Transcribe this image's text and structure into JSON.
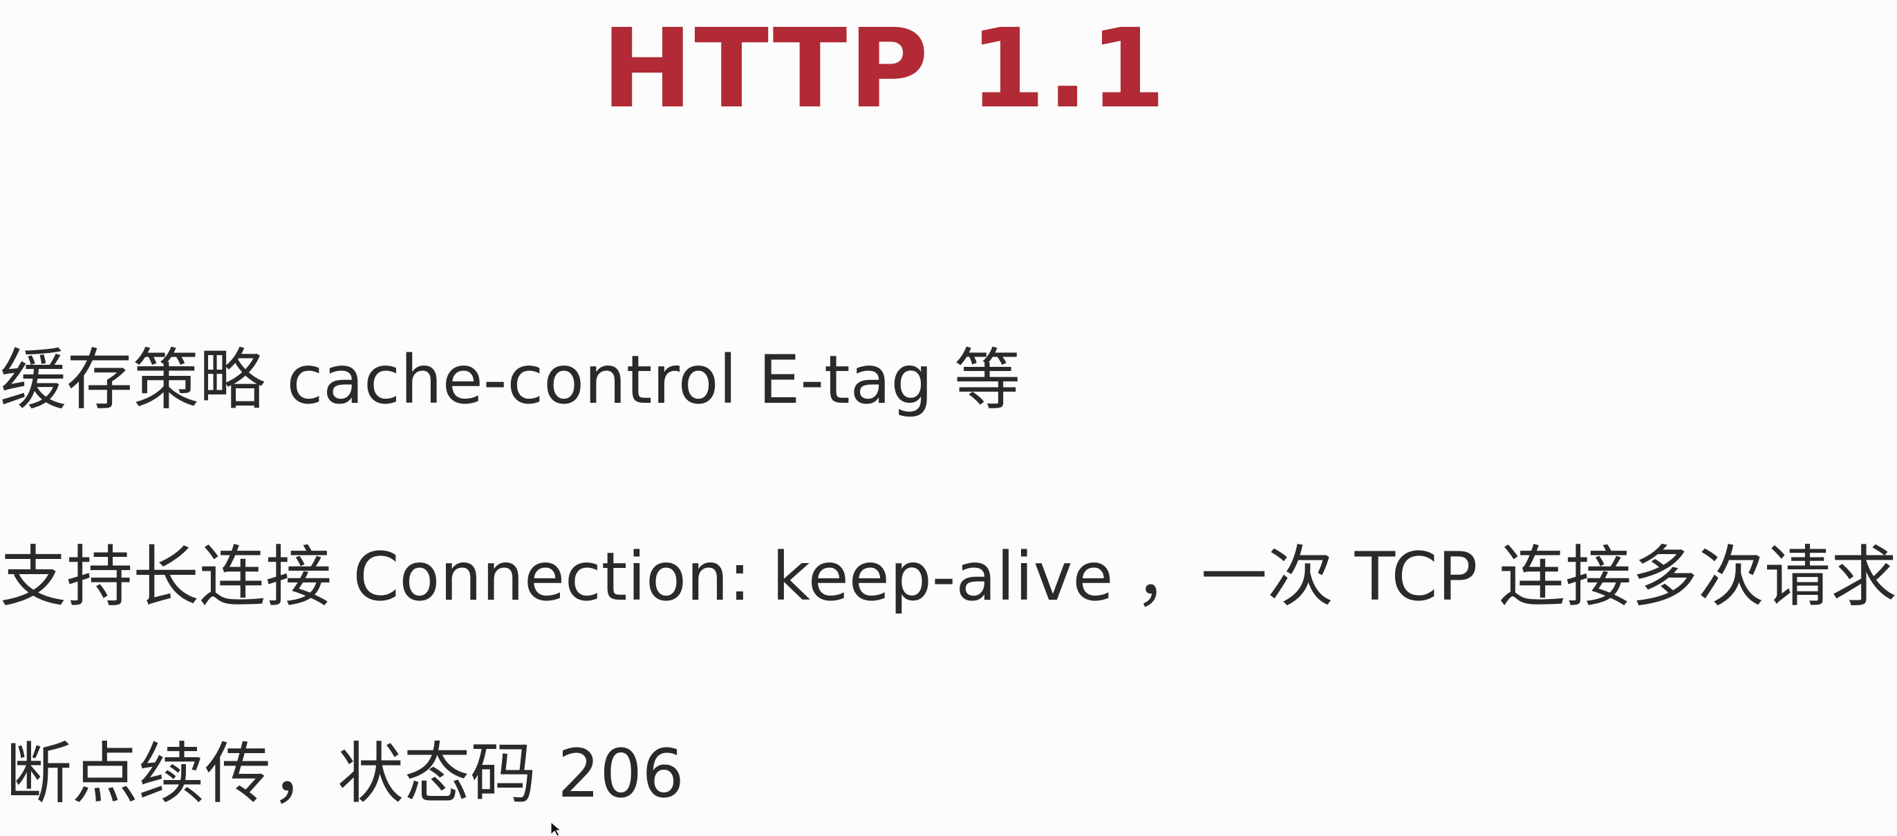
{
  "slide": {
    "title": "HTTP 1.1",
    "bullets": [
      "缓存策略 cache-control E-tag 等",
      "支持长连接 Connection: keep-alive  ，一次 TCP 连接多次请求",
      "断点续传，状态码 206"
    ]
  },
  "colors": {
    "title": "#b12a35",
    "text": "#2a2a2a",
    "background": "#fcfcfc"
  },
  "icons": {
    "pointer": "mouse-pointer-icon"
  }
}
